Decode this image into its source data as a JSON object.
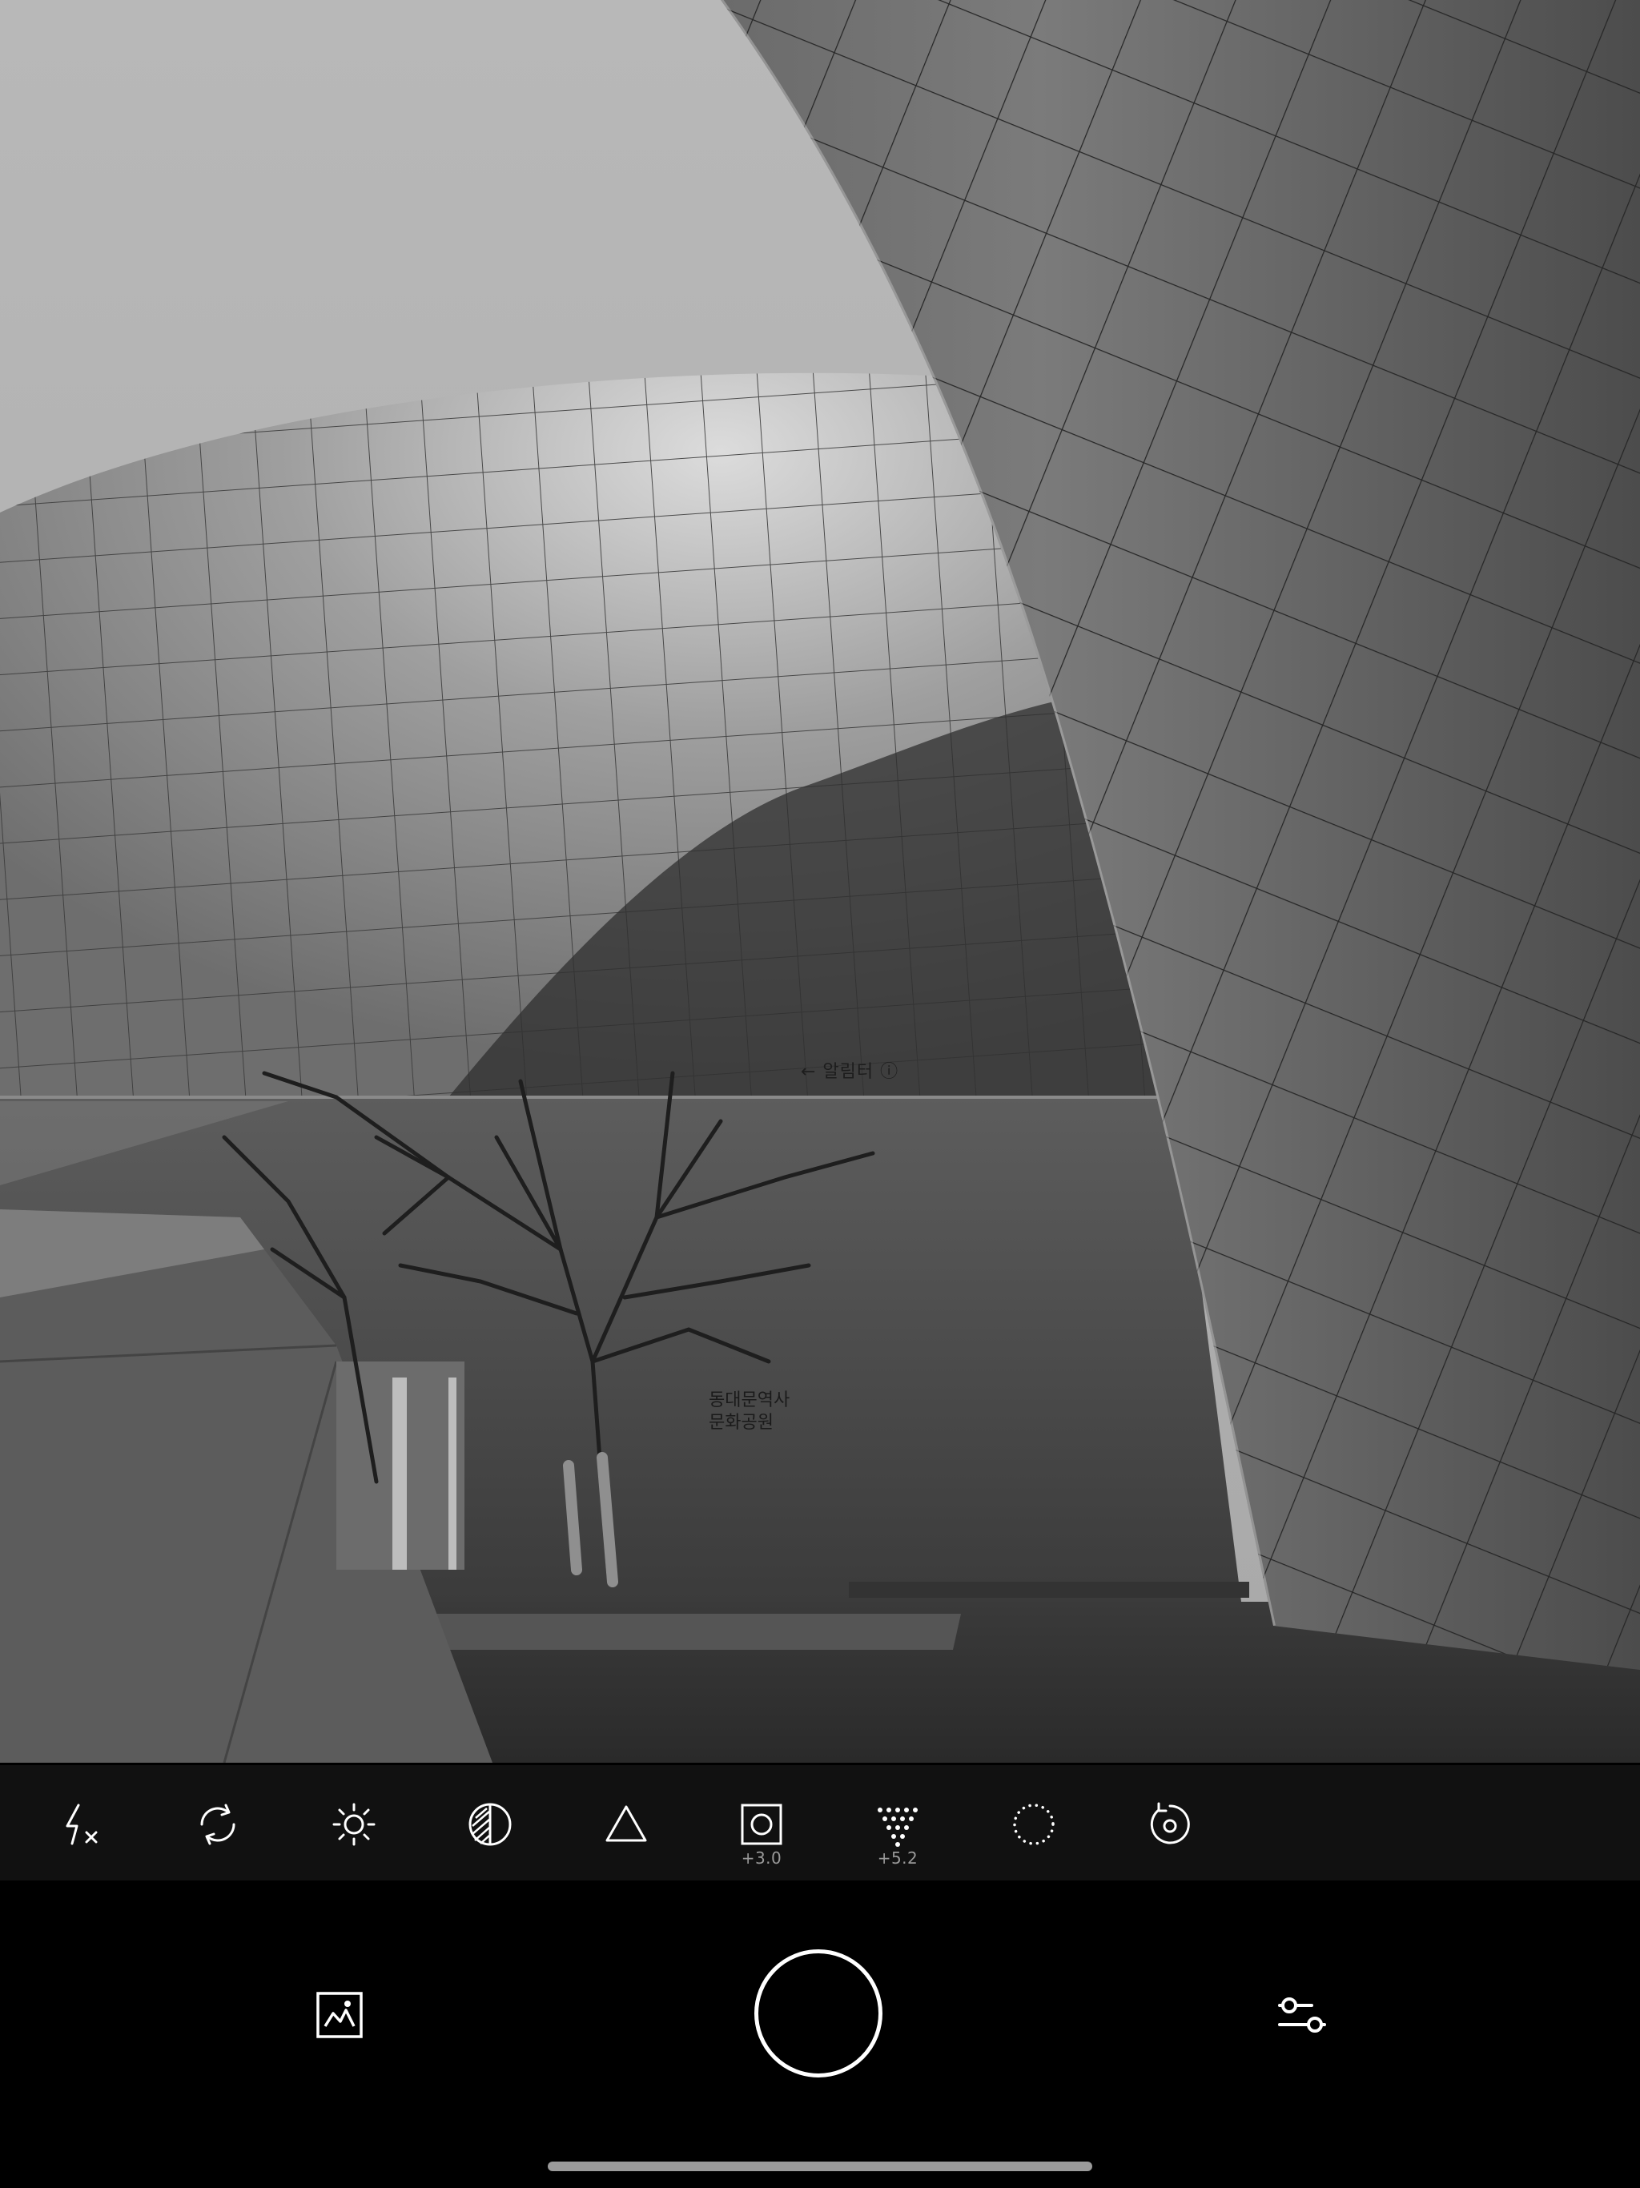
{
  "viewfinder": {
    "scene": "black-and-white-photo",
    "wall_sign": "← 알림터 ⓘ",
    "building_sign": "동대문역사\n문화공원"
  },
  "toolbar": {
    "tools": [
      {
        "name": "flash-off",
        "icon": "flash-off-icon",
        "value": ""
      },
      {
        "name": "switch-camera",
        "icon": "rotate-camera-icon",
        "value": ""
      },
      {
        "name": "exposure",
        "icon": "sun-icon",
        "value": ""
      },
      {
        "name": "contrast",
        "icon": "contrast-icon",
        "value": ""
      },
      {
        "name": "triangle",
        "icon": "triangle-icon",
        "value": ""
      },
      {
        "name": "square",
        "icon": "square-circle-icon",
        "value": "+3.0"
      },
      {
        "name": "grain",
        "icon": "dots-triangle-icon",
        "value": "+5.2"
      },
      {
        "name": "vignette",
        "icon": "dotted-circle-icon",
        "value": ""
      },
      {
        "name": "timer",
        "icon": "timer-icon",
        "value": ""
      }
    ]
  },
  "controls": {
    "gallery_icon": "image-icon",
    "shutter_icon": "shutter-button",
    "settings_icon": "sliders-icon"
  },
  "colors": {
    "toolbar_bg": "#111111",
    "controls_bg": "#000000",
    "icon": "#ffffff",
    "value_text": "#9a9a9a",
    "home_indicator": "#9b9b9b"
  }
}
